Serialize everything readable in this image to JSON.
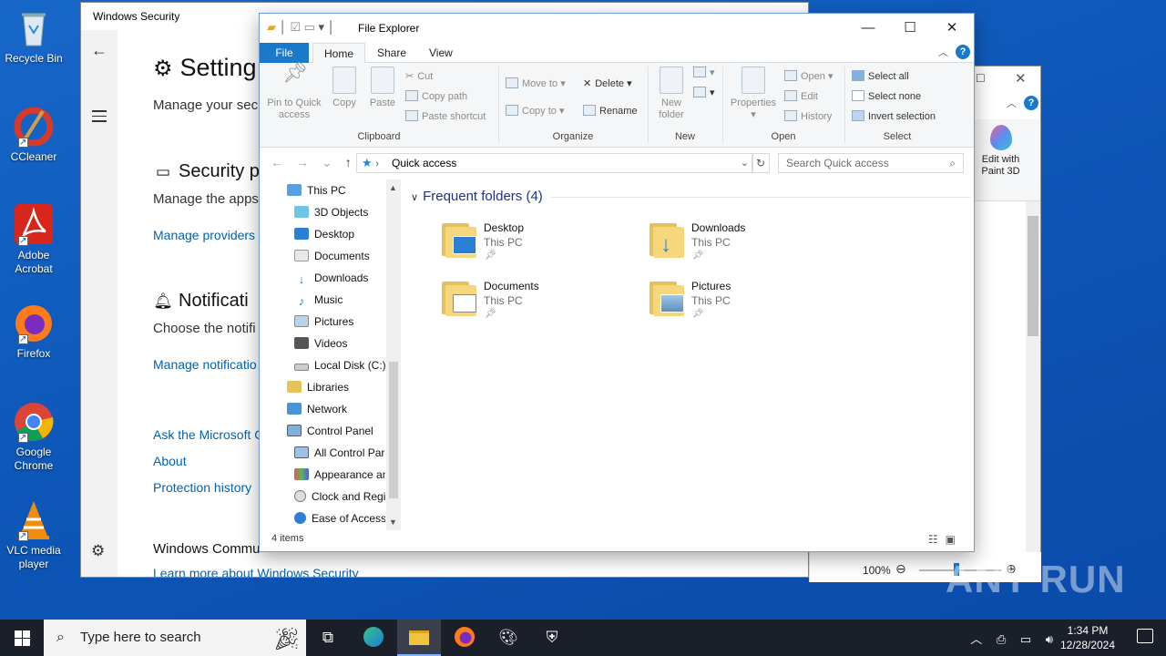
{
  "desktop": {
    "icons": [
      {
        "label": "Recycle Bin"
      },
      {
        "label": "CCleaner"
      },
      {
        "label": "Adobe Acrobat"
      },
      {
        "label": "Firefox"
      },
      {
        "label": "Google Chrome"
      },
      {
        "label": "VLC media player"
      }
    ]
  },
  "windows_security": {
    "title": "Windows Security",
    "heading": "Setting",
    "subheading": "Manage your secu",
    "sections": [
      {
        "title": "Security p",
        "desc": "Manage the apps",
        "link": "Manage providers"
      },
      {
        "title": "Notificati",
        "desc": "Choose the notifi",
        "link": "Manage notificatio"
      }
    ],
    "links": [
      "Ask the Microsoft C",
      "About",
      "Protection history"
    ],
    "community": "Windows Commu",
    "learn_more": "Learn more about Windows Security"
  },
  "paint3d": {
    "ribbon_button": "Edit with Paint 3D",
    "zoom": "100%"
  },
  "explorer": {
    "title": "File Explorer",
    "tabs": {
      "file": "File",
      "home": "Home",
      "share": "Share",
      "view": "View"
    },
    "ribbon": {
      "clipboard": {
        "label": "Clipboard",
        "pin": "Pin to Quick access",
        "copy": "Copy",
        "paste": "Paste",
        "cut": "Cut",
        "copy_path": "Copy path",
        "paste_shortcut": "Paste shortcut"
      },
      "organize": {
        "label": "Organize",
        "move_to": "Move to",
        "copy_to": "Copy to",
        "delete": "Delete",
        "rename": "Rename"
      },
      "new": {
        "label": "New",
        "new_folder": "New folder"
      },
      "open": {
        "label": "Open",
        "properties": "Properties",
        "open": "Open",
        "edit": "Edit",
        "history": "History"
      },
      "select": {
        "label": "Select",
        "select_all": "Select all",
        "select_none": "Select none",
        "invert": "Invert selection"
      }
    },
    "address": "Quick access",
    "search_placeholder": "Search Quick access",
    "nav": [
      "This PC",
      "3D Objects",
      "Desktop",
      "Documents",
      "Downloads",
      "Music",
      "Pictures",
      "Videos",
      "Local Disk (C:)",
      "Libraries",
      "Network",
      "Control Panel",
      "All Control Par",
      "Appearance an",
      "Clock and Regi",
      "Ease of Access"
    ],
    "group_title": "Frequent folders (4)",
    "folders": [
      {
        "name": "Desktop",
        "location": "This PC"
      },
      {
        "name": "Downloads",
        "location": "This PC"
      },
      {
        "name": "Documents",
        "location": "This PC"
      },
      {
        "name": "Pictures",
        "location": "This PC"
      }
    ],
    "status": "4 items"
  },
  "taskbar": {
    "search_placeholder": "Type here to search",
    "time": "1:34 PM",
    "date": "12/28/2024"
  },
  "watermark": "ANY RUN",
  "colors": {
    "accent": "#1979ca",
    "link": "#0063b1",
    "taskbar": "#1b1f2a"
  }
}
